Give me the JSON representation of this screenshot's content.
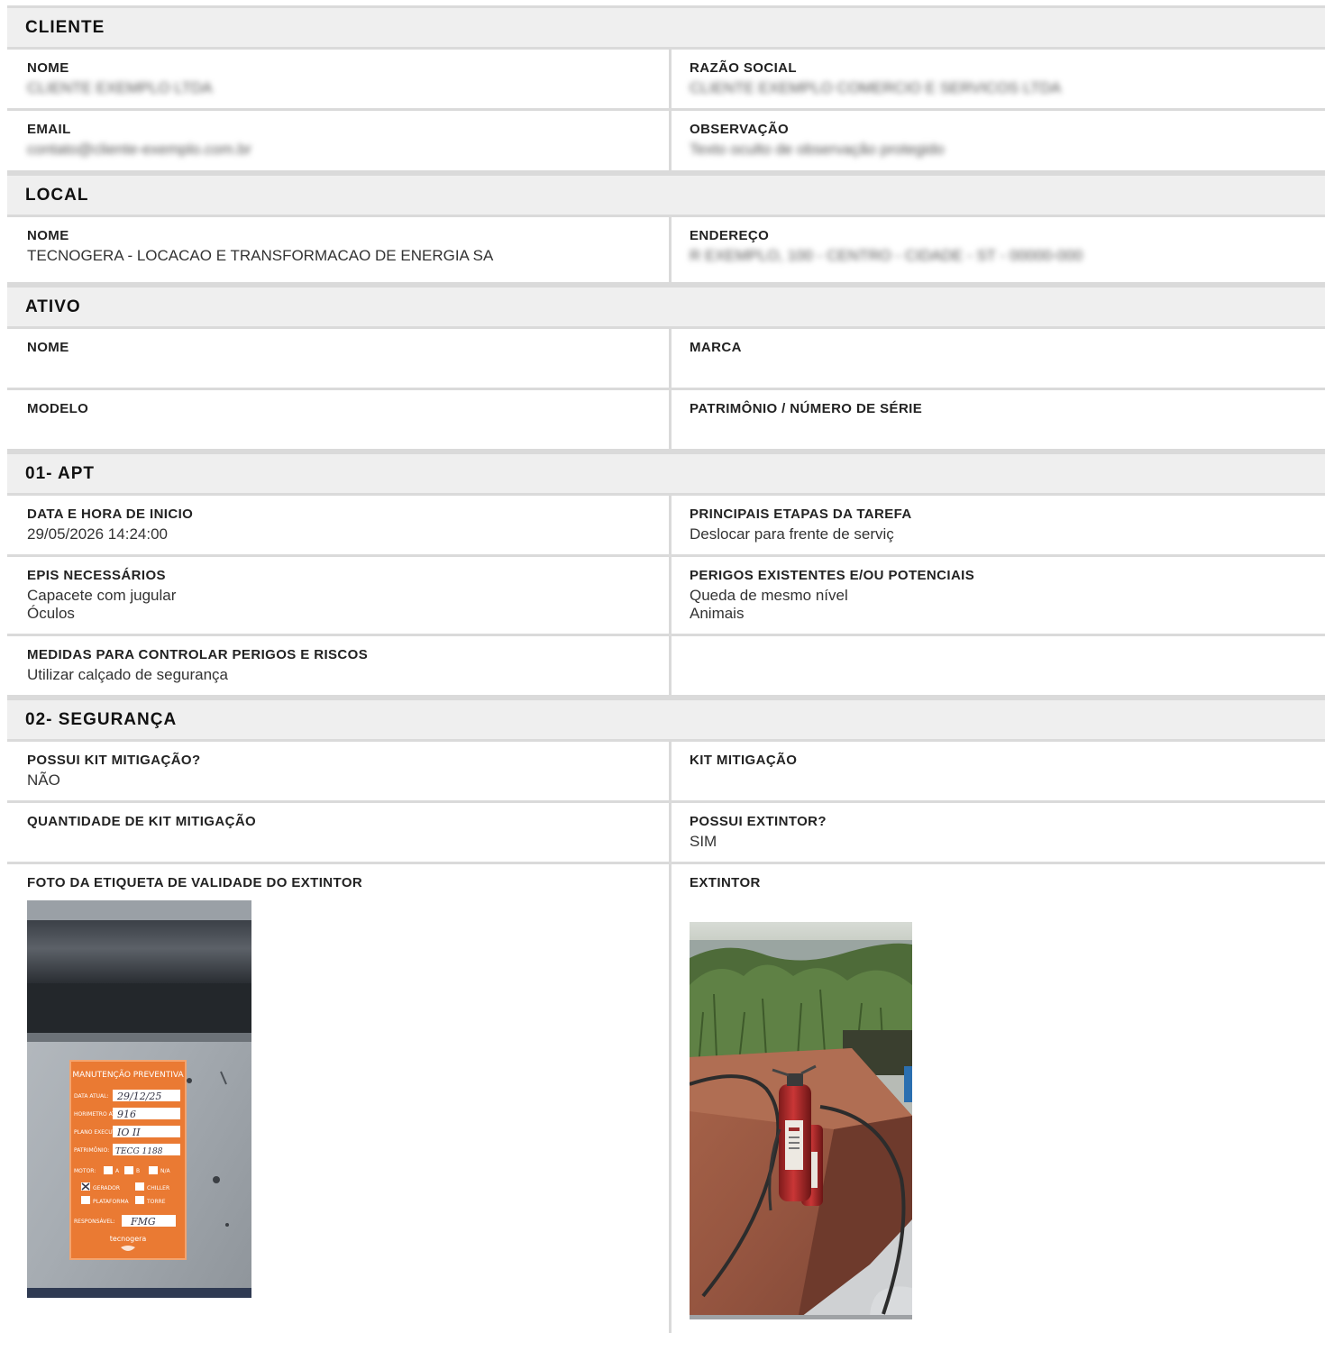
{
  "cliente": {
    "title": "CLIENTE",
    "nome_label": "NOME",
    "nome_value": "CLIENTE EXEMPLO LTDA",
    "razao_label": "RAZÃO SOCIAL",
    "razao_value": "CLIENTE EXEMPLO COMERCIO E SERVICOS LTDA",
    "email_label": "EMAIL",
    "email_value": "contato@cliente-exemplo.com.br",
    "obs_label": "OBSERVAÇÃO",
    "obs_value": "Texto oculto de observação protegido"
  },
  "local": {
    "title": "LOCAL",
    "nome_label": "NOME",
    "nome_value": "TECNOGERA - LOCACAO E TRANSFORMACAO DE ENERGIA SA",
    "endereco_label": "ENDEREÇO",
    "endereco_value": "R EXEMPLO, 100 - CENTRO - CIDADE - ST - 00000-000"
  },
  "ativo": {
    "title": "ATIVO",
    "nome_label": "NOME",
    "nome_value": "",
    "marca_label": "MARCA",
    "marca_value": "",
    "modelo_label": "MODELO",
    "modelo_value": "",
    "patrimonio_label": "PATRIMÔNIO / NÚMERO DE SÉRIE",
    "patrimonio_value": ""
  },
  "apt": {
    "title": "01- APT",
    "inicio_label": "DATA E HORA DE INICIO",
    "inicio_value": "29/05/2026 14:24:00",
    "etapas_label": "PRINCIPAIS ETAPAS DA TAREFA",
    "etapas_value": "Deslocar para frente de serviç",
    "epis_label": "EPIS NECESSÁRIOS",
    "epis_value": "Capacete com jugular\nÓculos",
    "perigos_label": "PERIGOS EXISTENTES E/OU POTENCIAIS",
    "perigos_value": "Queda de mesmo nível\nAnimais",
    "medidas_label": "MEDIDAS PARA CONTROLAR PERIGOS E RISCOS",
    "medidas_value": "Utilizar calçado de segurança"
  },
  "seguranca": {
    "title": "02- SEGURANÇA",
    "possui_kit_label": "POSSUI KIT MITIGAÇÃO?",
    "possui_kit_value": "NÃO",
    "kit_label": "KIT MITIGAÇÃO",
    "kit_value": "",
    "qtd_kit_label": "QUANTIDADE DE KIT MITIGAÇÃO",
    "qtd_kit_value": "",
    "possui_extintor_label": "POSSUI EXTINTOR?",
    "possui_extintor_value": "SIM",
    "foto_etiqueta_label": "FOTO DA ETIQUETA DE VALIDADE DO EXTINTOR",
    "extintor_label": "EXTINTOR",
    "tag": {
      "header": "MANUTENÇÃO PREVENTIVA",
      "data_label": "DATA ATUAL:",
      "data_value": "29/12/25",
      "horimetro_label": "HORIMETRO ATUAL:",
      "horimetro_value": "916",
      "plano_label": "PLANO EXECUTADO:",
      "plano_value": "IO II",
      "patrimonio_label": "PATRIMÔNIO:",
      "patrimonio_value": "TECG 1188",
      "motor_label": "MOTOR:",
      "opt_a": "A",
      "opt_b": "B",
      "opt_na": "N/A",
      "opt_gerador": "GERADOR",
      "opt_chiller": "CHILLER",
      "opt_plataforma": "PLATAFORMA",
      "opt_torre": "TORRE",
      "responsavel_label": "RESPONSÁVEL:",
      "responsavel_value": "FMG",
      "brand": "tecnogera"
    }
  }
}
